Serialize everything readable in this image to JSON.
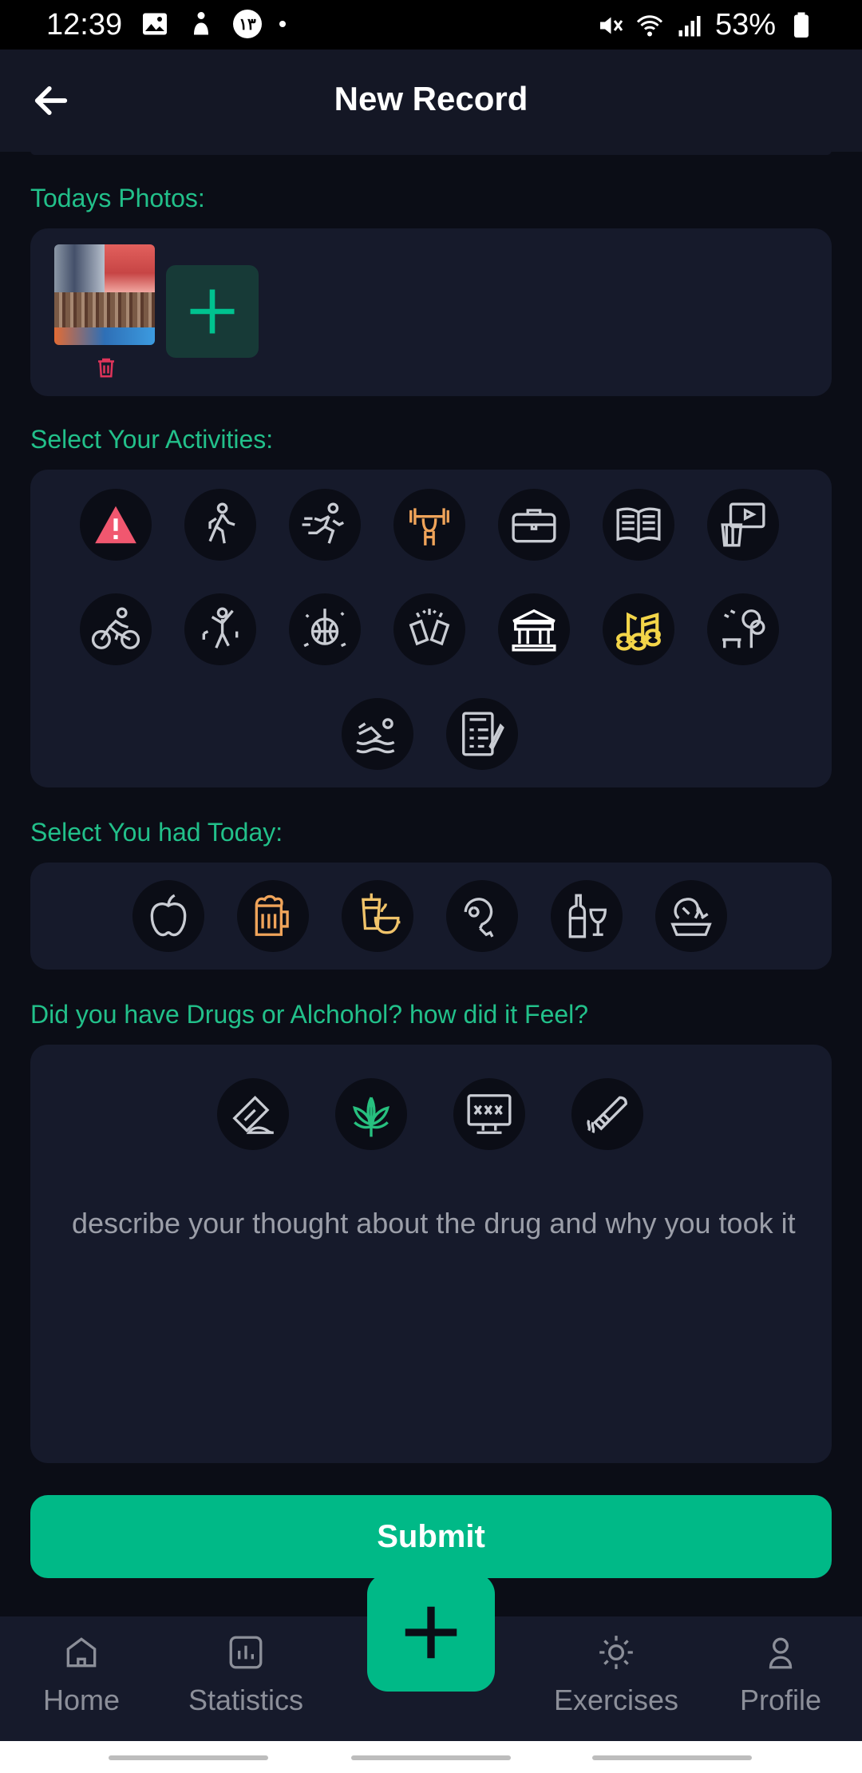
{
  "status_bar": {
    "time": "12:39",
    "battery": "53%",
    "extra_badge": "۱۳"
  },
  "app_bar": {
    "title": "New Record"
  },
  "sections": {
    "photos_label": "Todays Photos:",
    "activities_label": "Select Your Activities:",
    "had_today_label": "Select You had Today:",
    "drugs_label": "Did you have Drugs or Alchohol? how did it Feel?"
  },
  "activities": [
    {
      "icon": "warning-icon",
      "color": "#f1576f"
    },
    {
      "icon": "walking-icon",
      "color": "#c9ccd3"
    },
    {
      "icon": "running-icon",
      "color": "#c9ccd3"
    },
    {
      "icon": "weightlifting-icon",
      "color": "#f0a45a"
    },
    {
      "icon": "briefcase-icon",
      "color": "#c9ccd3"
    },
    {
      "icon": "book-icon",
      "color": "#c9ccd3"
    },
    {
      "icon": "cinema-icon",
      "color": "#c9ccd3"
    },
    {
      "icon": "cycling-icon",
      "color": "#c9ccd3"
    },
    {
      "icon": "dancing-icon",
      "color": "#c9ccd3"
    },
    {
      "icon": "disco-ball-icon",
      "color": "#c9ccd3"
    },
    {
      "icon": "cheers-icon",
      "color": "#c9ccd3"
    },
    {
      "icon": "museum-icon",
      "color": "#ffffff"
    },
    {
      "icon": "music-icon",
      "color": "#f3d549"
    },
    {
      "icon": "park-icon",
      "color": "#c9ccd3"
    },
    {
      "icon": "swimming-icon",
      "color": "#c9ccd3"
    },
    {
      "icon": "test-icon",
      "color": "#c9ccd3"
    }
  ],
  "had_today": [
    {
      "icon": "apple-icon",
      "color": "#c9ccd3"
    },
    {
      "icon": "beer-icon",
      "color": "#f0a45a"
    },
    {
      "icon": "fast-food-icon",
      "color": "#f0c36a"
    },
    {
      "icon": "meat-icon",
      "color": "#c9ccd3"
    },
    {
      "icon": "wine-icon",
      "color": "#c9ccd3"
    },
    {
      "icon": "vegetables-icon",
      "color": "#c9ccd3"
    }
  ],
  "drugs": [
    {
      "icon": "cocaine-icon",
      "color": "#c9ccd3"
    },
    {
      "icon": "cannabis-icon",
      "color": "#27c07f"
    },
    {
      "icon": "xxx-screen-icon",
      "color": "#c9ccd3"
    },
    {
      "icon": "cigar-icon",
      "color": "#c9ccd3"
    }
  ],
  "drug_textarea": {
    "placeholder": "describe your thought about the drug and why you took it",
    "value": ""
  },
  "submit_label": "Submit",
  "nav": {
    "home": "Home",
    "statistics": "Statistics",
    "exercises": "Exercises",
    "profile": "Profile"
  },
  "colors": {
    "accent": "#00b987",
    "label": "#22c08a",
    "background": "#0b0d16",
    "card": "#161a2b"
  }
}
